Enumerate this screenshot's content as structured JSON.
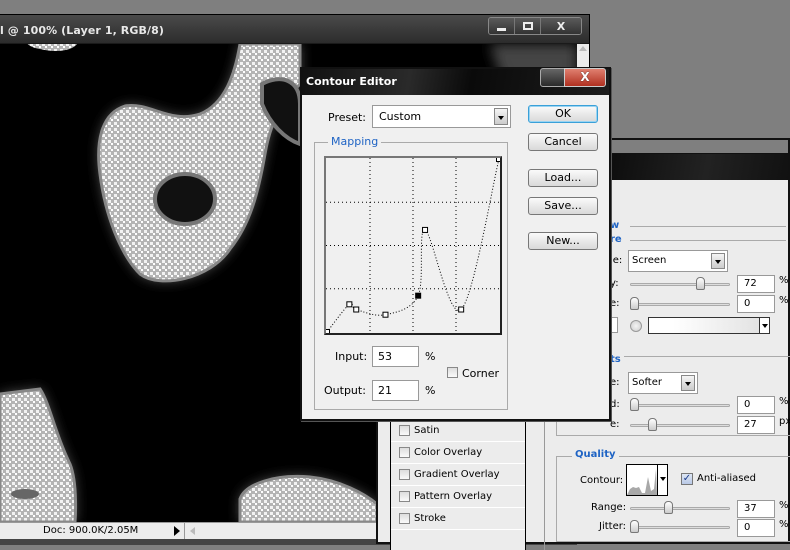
{
  "document_window": {
    "title": "l @ 100% (Layer 1, RGB/8)",
    "controls": {
      "minimize": "▁",
      "maximize": "□",
      "close": "X"
    },
    "status": "Doc: 900.0K/2.05M"
  },
  "layer_style": {
    "styles_list": [
      {
        "label": "Satin",
        "checked": false
      },
      {
        "label": "Color Overlay",
        "checked": false
      },
      {
        "label": "Gradient Overlay",
        "checked": false
      },
      {
        "label": "Pattern Overlay",
        "checked": false
      },
      {
        "label": "Stroke",
        "checked": false
      }
    ],
    "section_1_label": "w",
    "section_2_label": "re",
    "blend_mode_label": "le:",
    "blend_mode_value": "Screen",
    "opacity_label": "y:",
    "opacity_value": "72",
    "opacity_unit": "%",
    "noise_label": "e:",
    "noise_value": "0",
    "noise_unit": "%",
    "elements_label": "ts",
    "technique_label": "e:",
    "technique_value": "Softer",
    "spread_label": "d:",
    "spread_value": "0",
    "spread_unit": "%",
    "size_label": "e:",
    "size_value": "27",
    "size_unit": "px",
    "quality_label": "Quality",
    "contour_label": "Contour:",
    "anti_aliased_label": "Anti-aliased",
    "anti_aliased_checked": true,
    "range_label": "Range:",
    "range_value": "37",
    "range_unit": "%",
    "jitter_label": "Jitter:",
    "jitter_value": "0",
    "jitter_unit": "%",
    "slider_levels": {
      "opacity": 72,
      "noise": 0,
      "spread": 0,
      "size_fraction": 0.2,
      "range": 37,
      "jitter": 0
    }
  },
  "contour_editor": {
    "title": "Contour Editor",
    "close_label": "X",
    "preset_label": "Preset:",
    "preset_value": "Custom",
    "mapping_label": "Mapping",
    "input_label": "Input:",
    "input_value": "53",
    "input_unit": "%",
    "output_label": "Output:",
    "output_value": "21",
    "output_unit": "%",
    "corner_label": "Corner",
    "corner_checked": false,
    "buttons": {
      "ok": "OK",
      "cancel": "Cancel",
      "load": "Load...",
      "save": "Save...",
      "new": "New..."
    },
    "curve_points": [
      {
        "input": 0,
        "output": 0
      },
      {
        "input": 13,
        "output": 16
      },
      {
        "input": 17,
        "output": 13
      },
      {
        "input": 34,
        "output": 10
      },
      {
        "input": 53,
        "output": 21,
        "selected": true
      },
      {
        "input": 57,
        "output": 59
      },
      {
        "input": 78,
        "output": 13
      },
      {
        "input": 100,
        "output": 100
      }
    ]
  }
}
